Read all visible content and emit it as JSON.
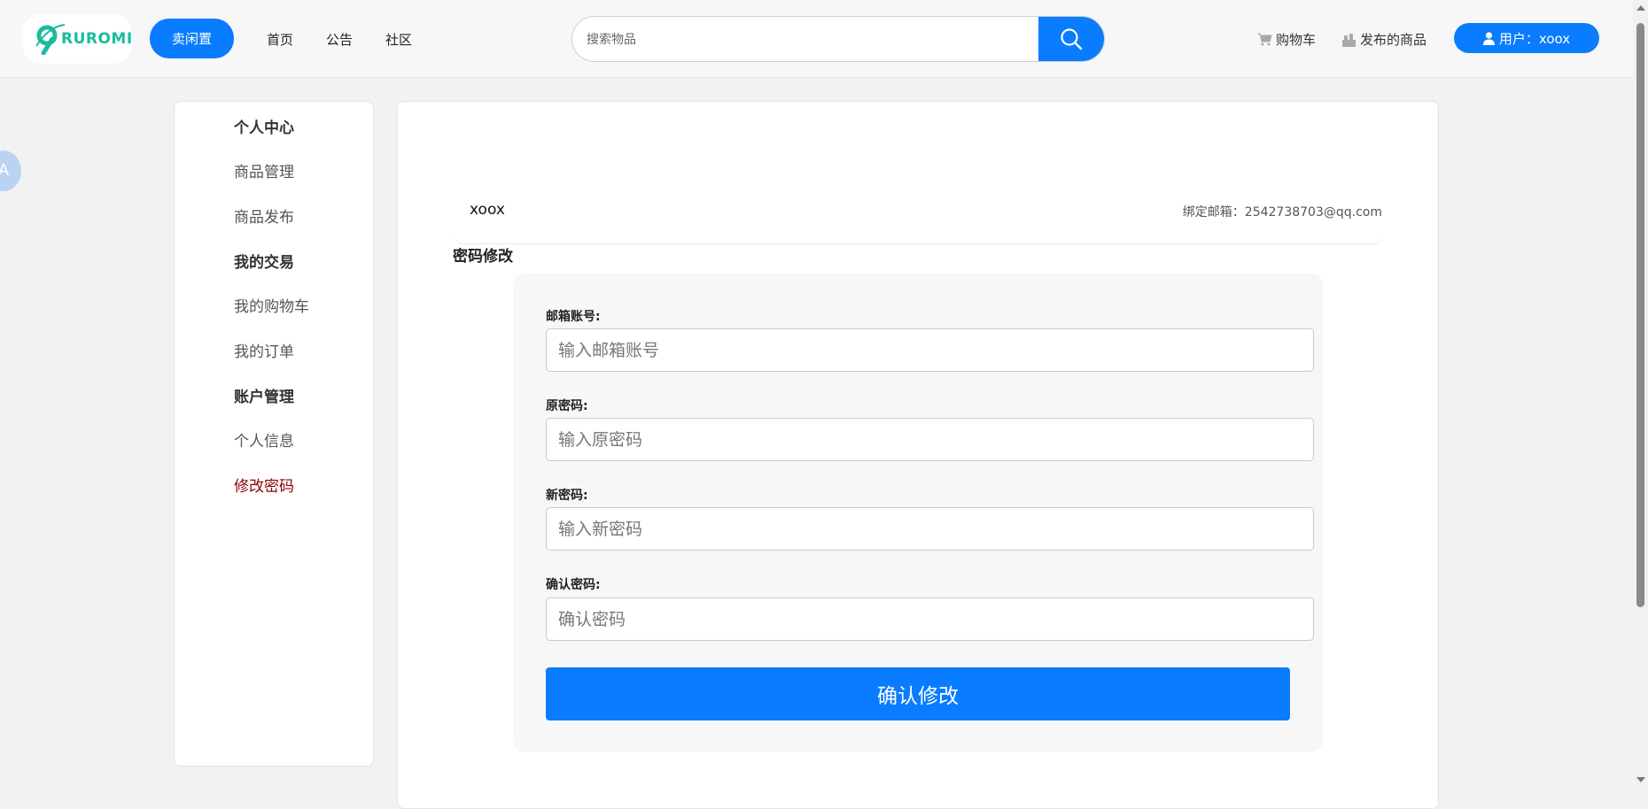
{
  "header": {
    "logo_text": "RUROMI",
    "sell_label": "卖闲置",
    "nav": [
      "首页",
      "公告",
      "社区"
    ],
    "search": {
      "placeholder": "搜索物品",
      "value": ""
    },
    "cart_label": "购物车",
    "published_label": "发布的商品",
    "user_label": "用户：xoox"
  },
  "translate_fab": "A",
  "sidebar": {
    "items": [
      {
        "label": "个人中心",
        "type": "heading"
      },
      {
        "label": "商品管理",
        "type": "link"
      },
      {
        "label": "商品发布",
        "type": "link"
      },
      {
        "label": "我的交易",
        "type": "heading"
      },
      {
        "label": "我的购物车",
        "type": "link"
      },
      {
        "label": "我的订单",
        "type": "link"
      },
      {
        "label": "账户管理",
        "type": "heading"
      },
      {
        "label": "个人信息",
        "type": "link"
      },
      {
        "label": "修改密码",
        "type": "link",
        "active": true
      }
    ]
  },
  "profile": {
    "username": "xoox",
    "email_text": "绑定邮箱：2542738703@qq.com"
  },
  "form": {
    "title": "密码修改",
    "fields": [
      {
        "label": "邮箱账号:",
        "placeholder": "输入邮箱账号",
        "value": ""
      },
      {
        "label": "原密码:",
        "placeholder": "输入原密码",
        "value": ""
      },
      {
        "label": "新密码:",
        "placeholder": "输入新密码",
        "value": ""
      },
      {
        "label": "确认密码:",
        "placeholder": "确认密码",
        "value": ""
      }
    ],
    "submit_label": "确认修改"
  },
  "colors": {
    "accent": "#0a7cff",
    "active_link": "#8b0000",
    "logo": "#1abc9c"
  }
}
